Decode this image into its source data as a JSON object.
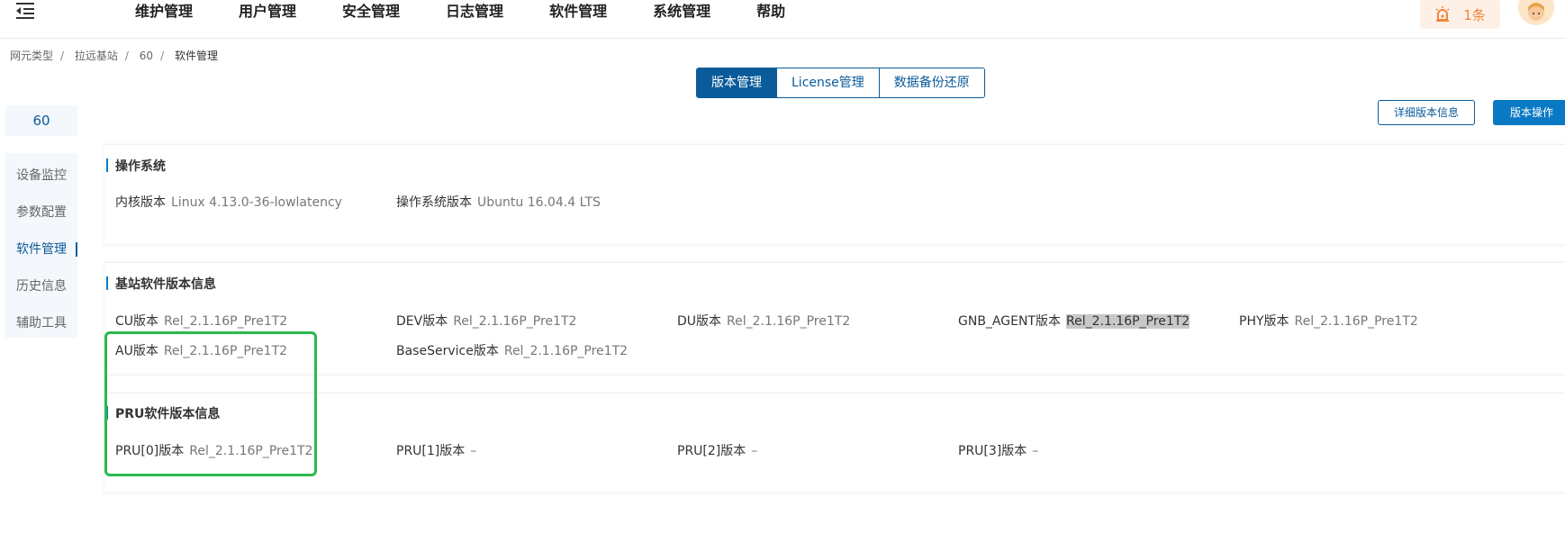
{
  "topbar": {
    "nav": [
      "维护管理",
      "用户管理",
      "安全管理",
      "日志管理",
      "软件管理",
      "系统管理",
      "帮助"
    ],
    "alarm_count": "1条",
    "colors": {
      "primary": "#0a5b9a",
      "alarm": "#f0853a",
      "highlight_box": "#2db84c"
    }
  },
  "breadcrumb": [
    "网元类型",
    "拉远基站",
    "60",
    "软件管理"
  ],
  "tabs": [
    "版本管理",
    "License管理",
    "数据备份还原"
  ],
  "sidebar": {
    "id": "60",
    "items": [
      "设备监控",
      "参数配置",
      "软件管理",
      "历史信息",
      "辅助工具"
    ]
  },
  "buttons": {
    "detail": "详细版本信息",
    "version_op": "版本操作"
  },
  "os_section": {
    "title": "操作系统",
    "kernel_label": "内核版本",
    "kernel_value": "Linux 4.13.0-36-lowlatency",
    "os_label": "操作系统版本",
    "os_value": "Ubuntu 16.04.4 LTS"
  },
  "bs_section": {
    "title": "基站软件版本信息",
    "fields": [
      {
        "label": "CU版本",
        "value": "Rel_2.1.16P_Pre1T2"
      },
      {
        "label": "DEV版本",
        "value": "Rel_2.1.16P_Pre1T2"
      },
      {
        "label": "DU版本",
        "value": "Rel_2.1.16P_Pre1T2"
      },
      {
        "label": "GNB_AGENT版本",
        "value": "Rel_2.1.16P_Pre1T2"
      },
      {
        "label": "PHY版本",
        "value": "Rel_2.1.16P_Pre1T2"
      },
      {
        "label": "AU版本",
        "value": "Rel_2.1.16P_Pre1T2"
      },
      {
        "label": "BaseService版本",
        "value": "Rel_2.1.16P_Pre1T2"
      }
    ]
  },
  "pru_section": {
    "title": "PRU软件版本信息",
    "fields": [
      {
        "label": "PRU[0]版本",
        "value": "Rel_2.1.16P_Pre1T2"
      },
      {
        "label": "PRU[1]版本",
        "value": "–"
      },
      {
        "label": "PRU[2]版本",
        "value": "–"
      },
      {
        "label": "PRU[3]版本",
        "value": "–"
      }
    ]
  }
}
